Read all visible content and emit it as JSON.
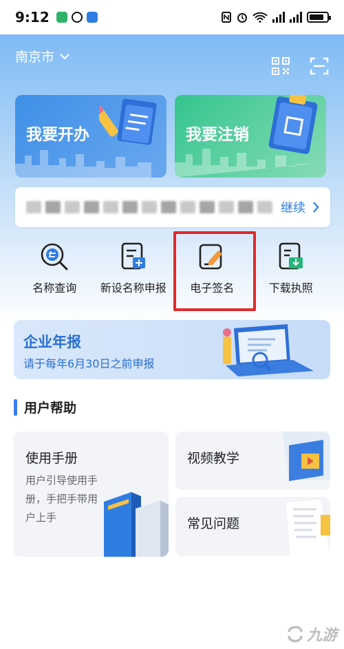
{
  "status_bar": {
    "time": "9:12"
  },
  "header": {
    "city": "南京市"
  },
  "actions": {
    "open_label": "我要开办",
    "cancel_label": "我要注销"
  },
  "continue_bar": {
    "link_label": "继续"
  },
  "quick": [
    {
      "label": "名称查询",
      "icon": "name-search-icon"
    },
    {
      "label": "新设名称申报",
      "icon": "new-name-apply-icon"
    },
    {
      "label": "电子签名",
      "icon": "e-signature-icon"
    },
    {
      "label": "下载执照",
      "icon": "download-license-icon"
    }
  ],
  "report": {
    "title": "企业年报",
    "subtitle": "请于每年6月30日之前申报"
  },
  "help": {
    "section_title": "用户帮助",
    "manual_title": "使用手册",
    "manual_desc": "用户引导使用手册，手把手带用户上手",
    "video_title": "视频教学",
    "faq_title": "常见问题"
  },
  "watermark": {
    "text": "九游"
  },
  "colors": {
    "accent_blue": "#2f7de1",
    "open_card": "#3f8fe8",
    "cancel_card": "#35c58e",
    "highlight_red": "#e02a2a"
  }
}
